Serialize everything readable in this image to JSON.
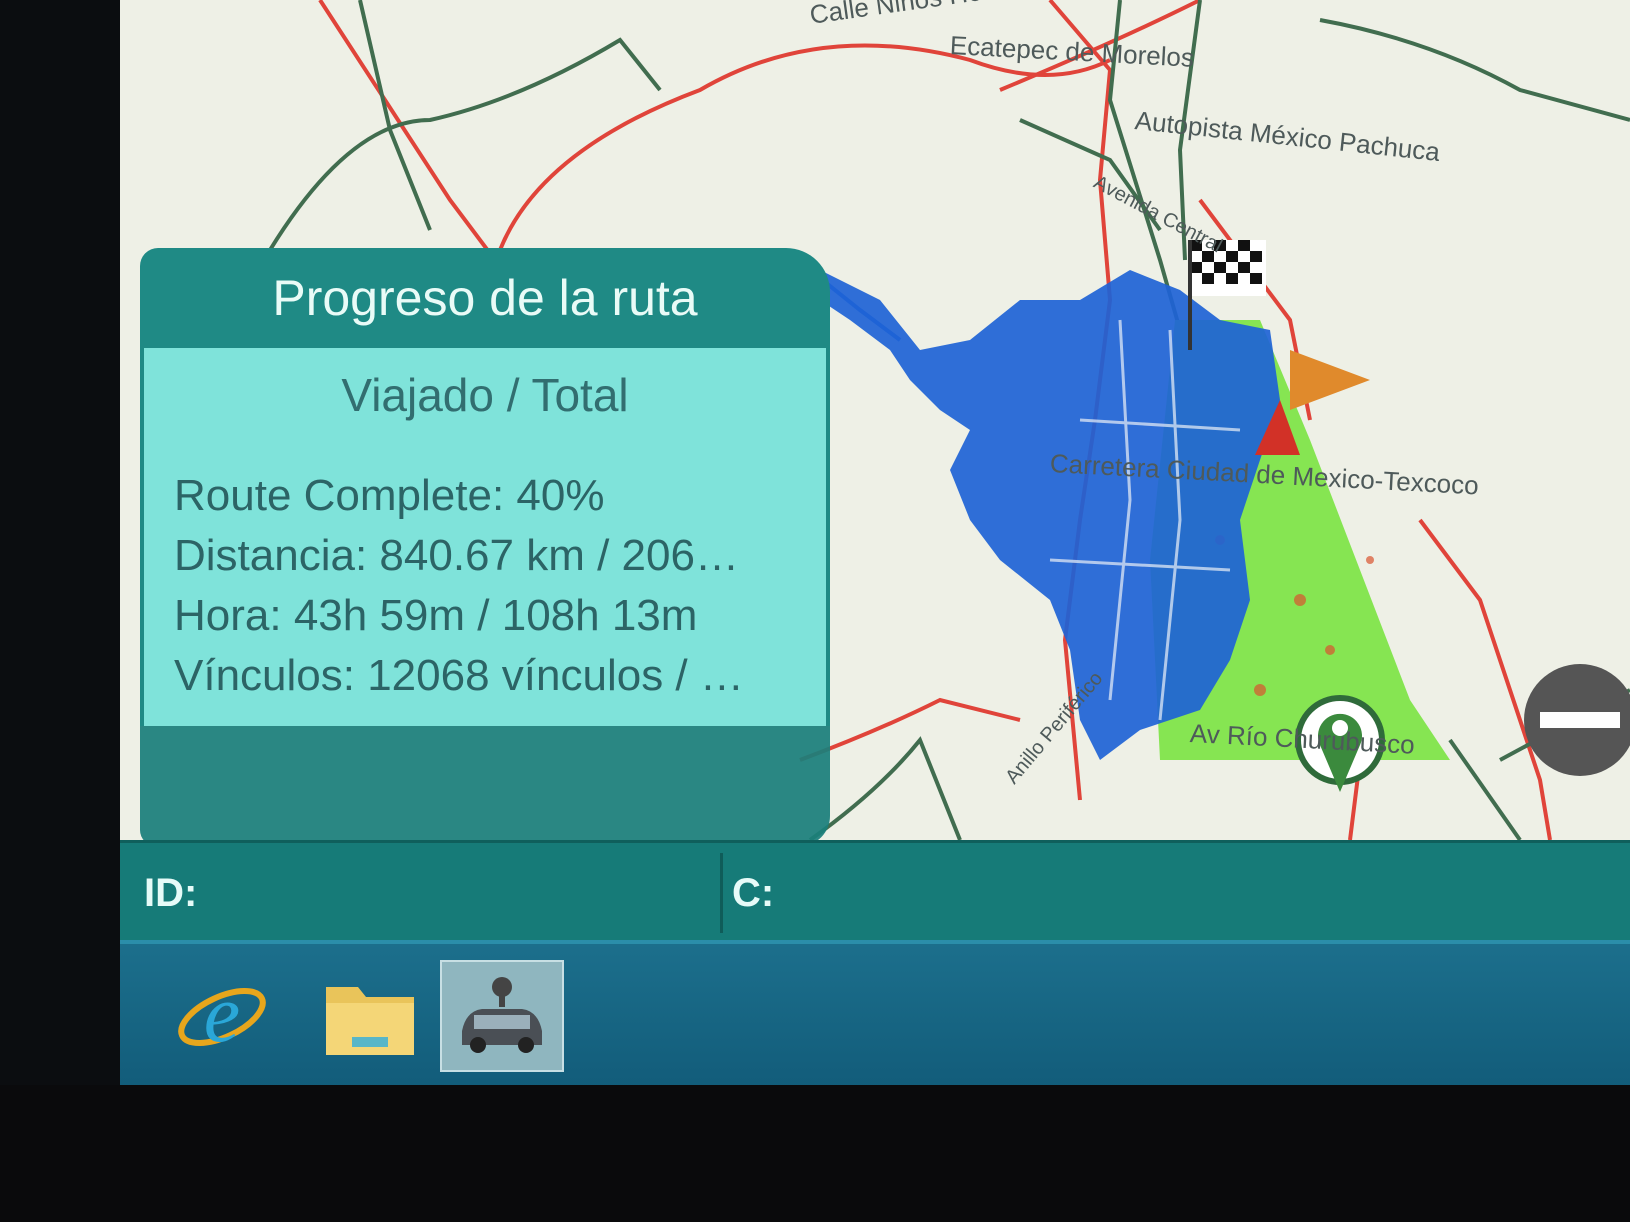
{
  "map": {
    "labels": [
      "Calle Niños Héroes",
      "Ecatepec de Morelos",
      "Autopista México Pachuca",
      "Carretera Ciudad de Mexico-Texcoco",
      "Av Río Churubusco",
      "Avenida Central",
      "Anillo Periférico"
    ]
  },
  "progress_panel": {
    "title": "Progreso de la ruta",
    "subtitle": "Viajado / Total",
    "lines": [
      "Route Complete: 40%",
      "Distancia: 840.67 km / 206…",
      "Hora: 43h 59m / 108h 13m",
      "Vínculos: 12068 vínculos / …"
    ],
    "route_complete_fraction": 0.4
  },
  "status_bar": {
    "id_label": "ID:",
    "c_label": "C:"
  },
  "taskbar": {
    "items": [
      "internet-explorer-icon",
      "folder-icon",
      "car-navigation-icon"
    ]
  },
  "colors": {
    "panel_header": "#1f8a85",
    "panel_body": "#7fe3da",
    "coverage_blue": "#1e63d6",
    "coverage_green": "#7fe44a",
    "road_red": "#e23a30",
    "road_green": "#3f6b4c"
  }
}
